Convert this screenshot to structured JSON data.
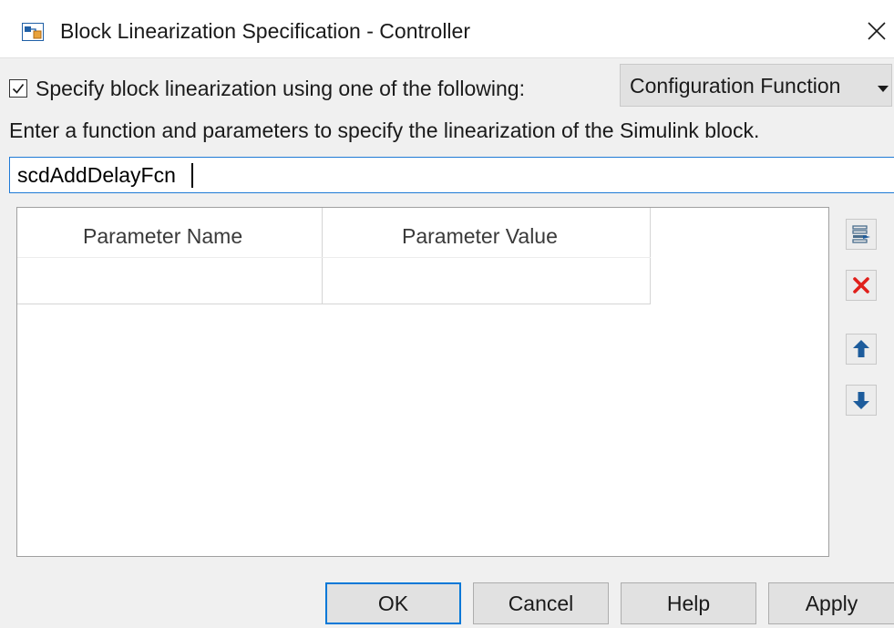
{
  "window": {
    "title": "Block Linearization Specification - Controller",
    "app_icon": "simulink-block-icon",
    "close_icon": "close-icon"
  },
  "spec": {
    "checkbox_checked": true,
    "checkbox_label": "Specify block linearization using one of the following:",
    "method_selected": "Configuration Function"
  },
  "instruction": "Enter a function and parameters to specify the linearization of the Simulink block.",
  "function_input": {
    "value": "scdAddDelayFcn"
  },
  "parameter_table": {
    "columns": [
      "Parameter Name",
      "Parameter Value"
    ],
    "rows": []
  },
  "side_buttons": [
    {
      "icon": "add-row-icon",
      "color": "#4a6d8c"
    },
    {
      "icon": "delete-icon",
      "color": "#e0201b"
    },
    {
      "icon": "arrow-up-icon",
      "color": "#1d5c9c"
    },
    {
      "icon": "arrow-down-icon",
      "color": "#1d5c9c"
    }
  ],
  "footer": {
    "ok_label": "OK",
    "cancel_label": "Cancel",
    "help_label": "Help",
    "apply_label": "Apply"
  },
  "colors": {
    "focus_blue": "#0078d7",
    "dialog_bg": "#f0f0f0"
  }
}
